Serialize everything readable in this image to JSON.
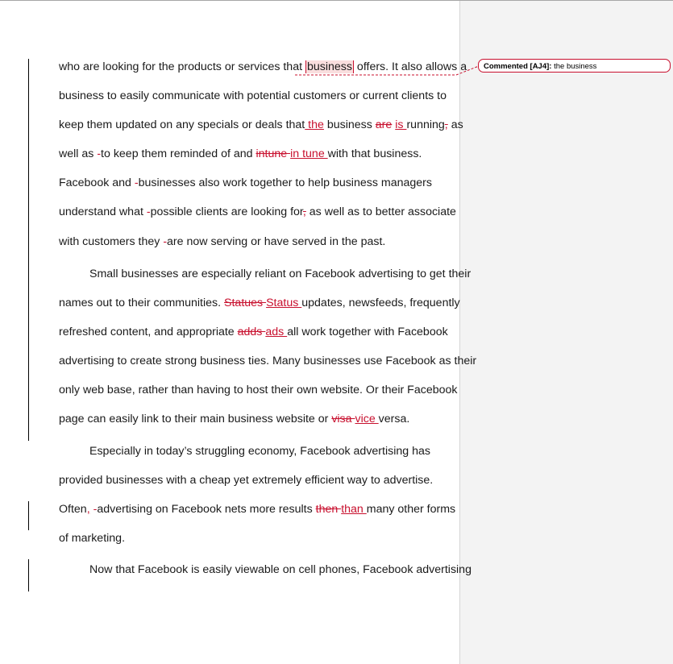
{
  "comment": {
    "author_tag": "Commented [AJ4]:",
    "text": " the business"
  },
  "lines": [
    {
      "segments": [
        {
          "t": "who are looking for the products or services that ",
          "c": "n"
        },
        {
          "t": "business",
          "c": "anchor"
        },
        {
          "t": " offers. It also allows a",
          "c": "n"
        }
      ]
    },
    {
      "segments": [
        {
          "t": "business to easily communicate with potential customers or current clients to",
          "c": "n"
        }
      ]
    },
    {
      "segments": [
        {
          "t": "keep them updated on any specials or deals that",
          "c": "n"
        },
        {
          "t": " the",
          "c": "ins"
        },
        {
          "t": " business ",
          "c": "n"
        },
        {
          "t": "are",
          "c": "del"
        },
        {
          "t": " ",
          "c": "n"
        },
        {
          "t": "is ",
          "c": "ins"
        },
        {
          "t": "running",
          "c": "n"
        },
        {
          "t": ",",
          "c": "del"
        },
        {
          "t": " as",
          "c": "n"
        }
      ]
    },
    {
      "segments": [
        {
          "t": "well as ",
          "c": "n"
        },
        {
          "t": "-",
          "c": "mark"
        },
        {
          "t": "to keep them reminded of and ",
          "c": "n"
        },
        {
          "t": "intune ",
          "c": "del"
        },
        {
          "t": "in tune ",
          "c": "ins"
        },
        {
          "t": "with that business.",
          "c": "n"
        }
      ]
    },
    {
      "segments": [
        {
          "t": "Facebook and ",
          "c": "n"
        },
        {
          "t": "-",
          "c": "mark"
        },
        {
          "t": "businesses also work together to help business managers",
          "c": "n"
        }
      ]
    },
    {
      "segments": [
        {
          "t": "understand what ",
          "c": "n"
        },
        {
          "t": "-",
          "c": "mark"
        },
        {
          "t": "possible clients are looking for",
          "c": "n"
        },
        {
          "t": ",",
          "c": "del"
        },
        {
          "t": " as well as to better associate",
          "c": "n"
        }
      ]
    },
    {
      "segments": [
        {
          "t": "with customers they ",
          "c": "n"
        },
        {
          "t": "-",
          "c": "mark"
        },
        {
          "t": "are now serving or have served in the past.",
          "c": "n"
        }
      ]
    },
    {
      "segments": [
        {
          "t": "Small businesses are especially reliant on Facebook advertising to get their",
          "c": "n"
        }
      ]
    },
    {
      "segments": [
        {
          "t": "names out to their communities. ",
          "c": "n"
        },
        {
          "t": "Statues ",
          "c": "del"
        },
        {
          "t": "Status ",
          "c": "ins"
        },
        {
          "t": "updates, newsfeeds, frequently",
          "c": "n"
        }
      ]
    },
    {
      "segments": [
        {
          "t": "refreshed content, and appropriate ",
          "c": "n"
        },
        {
          "t": "adds ",
          "c": "del"
        },
        {
          "t": "ads ",
          "c": "ins"
        },
        {
          "t": "all work together with Facebook",
          "c": "n"
        }
      ]
    },
    {
      "segments": [
        {
          "t": "advertising to create strong business ties. Many businesses use Facebook as their",
          "c": "n"
        }
      ]
    },
    {
      "segments": [
        {
          "t": "only web base, rather than having to host their own website. Or their Facebook",
          "c": "n"
        }
      ]
    },
    {
      "segments": [
        {
          "t": "page can easily link to their main business website or ",
          "c": "n"
        },
        {
          "t": "visa ",
          "c": "del"
        },
        {
          "t": "vice ",
          "c": "ins"
        },
        {
          "t": "versa.",
          "c": "n"
        }
      ]
    },
    {
      "segments": [
        {
          "t": "Especially in today’s struggling economy, Facebook advertising has",
          "c": "n"
        }
      ]
    },
    {
      "segments": [
        {
          "t": "provided businesses with a cheap yet extremely efficient way to advertise.",
          "c": "n"
        }
      ]
    },
    {
      "segments": [
        {
          "t": "Often",
          "c": "n"
        },
        {
          "t": ",",
          "c": "ins"
        },
        {
          "t": " ",
          "c": "n"
        },
        {
          "t": "-",
          "c": "mark"
        },
        {
          "t": "advertising on Facebook nets more results ",
          "c": "n"
        },
        {
          "t": "then ",
          "c": "del"
        },
        {
          "t": "than ",
          "c": "ins"
        },
        {
          "t": "many other forms",
          "c": "n"
        }
      ]
    },
    {
      "segments": [
        {
          "t": "of marketing.",
          "c": "n"
        }
      ]
    },
    {
      "segments": [
        {
          "t": "Now that Facebook is easily viewable on cell phones, Facebook advertising",
          "c": "n"
        }
      ]
    }
  ]
}
